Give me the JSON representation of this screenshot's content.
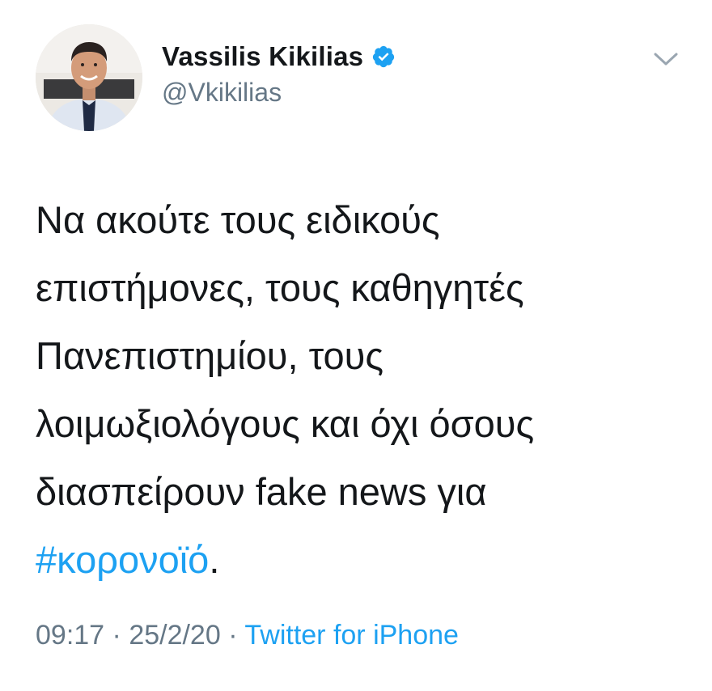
{
  "tweet": {
    "author": {
      "display_name": "Vassilis Kikilias",
      "handle": "@Vkikilias",
      "verified": true,
      "avatar_icon": "profile-photo"
    },
    "menu_icon": "chevron-down-icon",
    "body_lines": [
      "Να ακούτε τους ειδικούς",
      "επιστήμονες, τους καθηγητές",
      "Πανεπιστημίου, τους",
      "λοιμωξιολόγους και όχι όσους",
      "διασπείρουν fake news για"
    ],
    "hashtag": "#κορονοϊό",
    "hashtag_suffix": ".",
    "time": "09:17",
    "separator": " · ",
    "date": "25/2/20",
    "source": "Twitter for iPhone"
  },
  "colors": {
    "text": "#14171a",
    "secondary": "#657786",
    "link": "#1da1f2"
  }
}
